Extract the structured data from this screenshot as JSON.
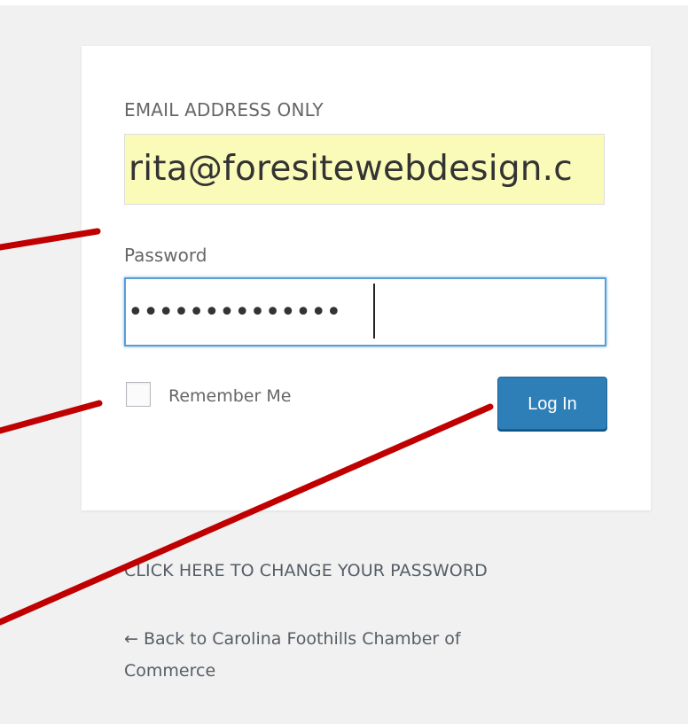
{
  "login_form": {
    "email_label": "EMAIL ADDRESS ONLY",
    "email_value": "rita@foresitewebdesign.c",
    "password_label": "Password",
    "password_masked": "••••••••••••••",
    "remember_label": "Remember Me",
    "remember_checked": false,
    "submit_label": "Log In"
  },
  "links": {
    "change_password": "CLICK HERE TO CHANGE YOUR PASSWORD",
    "back_to_site": "← Back to Carolina Foothills Chamber of Commerce"
  },
  "colors": {
    "page_background": "#f1f1f1",
    "autofill_background": "#fafbb9",
    "focus_border": "#5b9dd9",
    "button_primary": "#2e7fb8",
    "annotation_arrow": "#c00000"
  },
  "icons": {
    "checkbox": "checkbox-empty",
    "caret": "text-caret"
  }
}
